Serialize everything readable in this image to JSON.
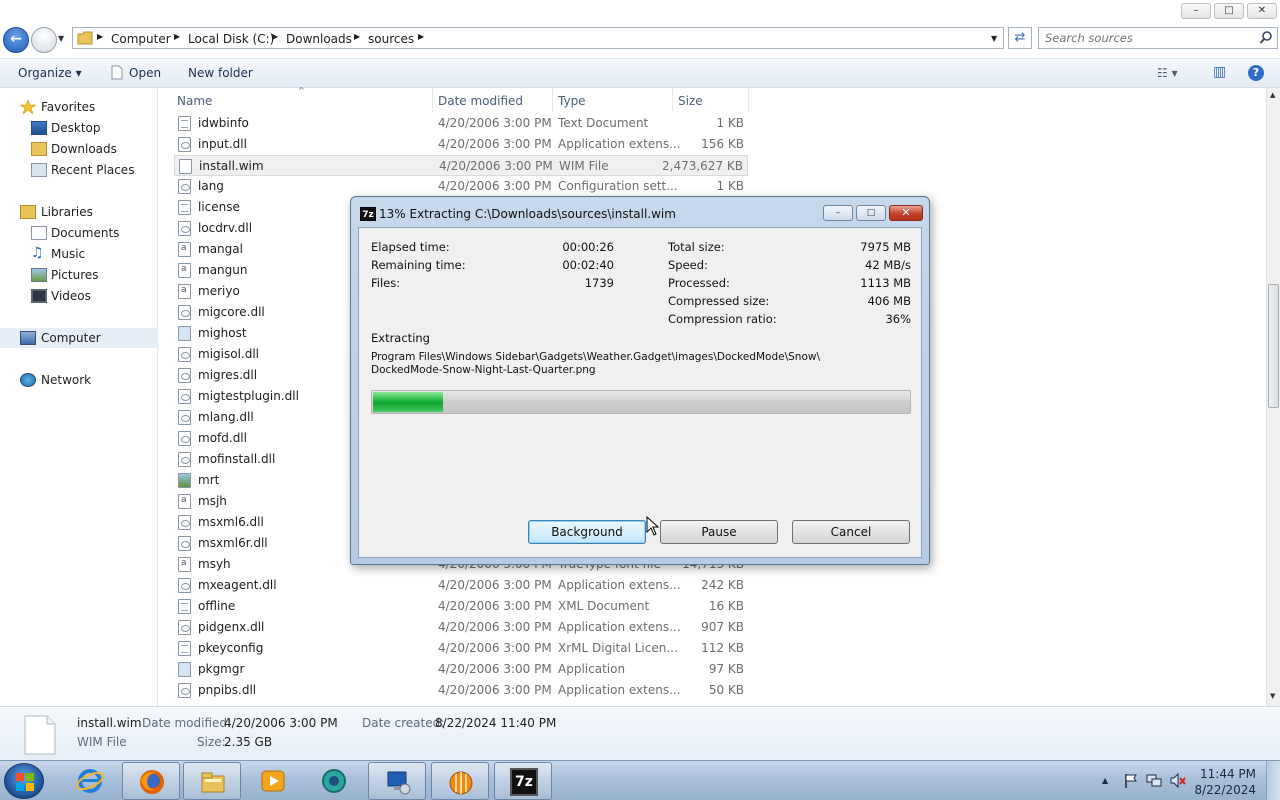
{
  "window": {
    "controls": {
      "minimize": "–",
      "maximize": "□",
      "close": "✕"
    }
  },
  "address": {
    "crumbs": [
      "Computer",
      "Local Disk (C:)",
      "Downloads",
      "sources"
    ],
    "separator": "▶",
    "dropdown": "▼",
    "refresh": "⇄"
  },
  "search": {
    "placeholder": "Search sources"
  },
  "toolbar": {
    "organize": "Organize ▾",
    "open": "Open",
    "new_folder": "New folder",
    "views": "☷ ▾",
    "preview": "▥",
    "help": "?"
  },
  "nav": {
    "favorites": "Favorites",
    "desktop": "Desktop",
    "downloads": "Downloads",
    "recent": "Recent Places",
    "libraries": "Libraries",
    "documents": "Documents",
    "music": "Music",
    "pictures": "Pictures",
    "videos": "Videos",
    "computer": "Computer",
    "network": "Network"
  },
  "columns": {
    "name": "Name",
    "date": "Date modified",
    "type": "Type",
    "size": "Size"
  },
  "files": [
    {
      "name": "idwbinfo",
      "date": "4/20/2006 3:00 PM",
      "type": "Text Document",
      "size": "1 KB",
      "icon": "txt"
    },
    {
      "name": "input.dll",
      "date": "4/20/2006 3:00 PM",
      "type": "Application extens...",
      "size": "156 KB",
      "icon": "dll"
    },
    {
      "name": "install.wim",
      "date": "4/20/2006 3:00 PM",
      "type": "WIM File",
      "size": "2,473,627 KB",
      "icon": "blank",
      "selected": true
    },
    {
      "name": "lang",
      "date": "4/20/2006 3:00 PM",
      "type": "Configuration sett...",
      "size": "1 KB",
      "icon": "dll"
    },
    {
      "name": "license",
      "date": "",
      "type": "",
      "size": "",
      "icon": "txt"
    },
    {
      "name": "locdrv.dll",
      "date": "",
      "type": "",
      "size": "",
      "icon": "dll"
    },
    {
      "name": "mangal",
      "date": "",
      "type": "",
      "size": "",
      "icon": "font"
    },
    {
      "name": "mangun",
      "date": "",
      "type": "",
      "size": "",
      "icon": "font"
    },
    {
      "name": "meriyo",
      "date": "",
      "type": "",
      "size": "",
      "icon": "font"
    },
    {
      "name": "migcore.dll",
      "date": "",
      "type": "",
      "size": "",
      "icon": "dll"
    },
    {
      "name": "mighost",
      "date": "",
      "type": "",
      "size": "",
      "icon": "app"
    },
    {
      "name": "migisol.dll",
      "date": "",
      "type": "",
      "size": "",
      "icon": "dll"
    },
    {
      "name": "migres.dll",
      "date": "",
      "type": "",
      "size": "",
      "icon": "dll"
    },
    {
      "name": "migtestplugin.dll",
      "date": "",
      "type": "",
      "size": "",
      "icon": "dll"
    },
    {
      "name": "mlang.dll",
      "date": "",
      "type": "",
      "size": "",
      "icon": "dll"
    },
    {
      "name": "mofd.dll",
      "date": "",
      "type": "",
      "size": "",
      "icon": "dll"
    },
    {
      "name": "mofinstall.dll",
      "date": "",
      "type": "",
      "size": "",
      "icon": "dll"
    },
    {
      "name": "mrt",
      "date": "",
      "type": "",
      "size": "",
      "icon": "img"
    },
    {
      "name": "msjh",
      "date": "",
      "type": "",
      "size": "",
      "icon": "font"
    },
    {
      "name": "msxml6.dll",
      "date": "",
      "type": "",
      "size": "",
      "icon": "dll"
    },
    {
      "name": "msxml6r.dll",
      "date": "",
      "type": "",
      "size": "",
      "icon": "dll"
    },
    {
      "name": "msyh",
      "date": "4/20/2006 3:00 PM",
      "type": "TrueType font file",
      "size": "14,713 KB",
      "icon": "font"
    },
    {
      "name": "mxeagent.dll",
      "date": "4/20/2006 3:00 PM",
      "type": "Application extens...",
      "size": "242 KB",
      "icon": "dll"
    },
    {
      "name": "offline",
      "date": "4/20/2006 3:00 PM",
      "type": "XML Document",
      "size": "16 KB",
      "icon": "txt"
    },
    {
      "name": "pidgenx.dll",
      "date": "4/20/2006 3:00 PM",
      "type": "Application extens...",
      "size": "907 KB",
      "icon": "dll"
    },
    {
      "name": "pkeyconfig",
      "date": "4/20/2006 3:00 PM",
      "type": "XrML Digital Licen...",
      "size": "112 KB",
      "icon": "txt"
    },
    {
      "name": "pkgmgr",
      "date": "4/20/2006 3:00 PM",
      "type": "Application",
      "size": "97 KB",
      "icon": "app"
    },
    {
      "name": "pnpibs.dll",
      "date": "4/20/2006 3:00 PM",
      "type": "Application extens...",
      "size": "50 KB",
      "icon": "dll"
    }
  ],
  "details": {
    "name": "install.wim",
    "kind": "WIM File",
    "modified_label": "Date modified:",
    "modified": "4/20/2006 3:00 PM",
    "created_label": "Date created:",
    "created": "8/22/2024 11:40 PM",
    "size_label": "Size:",
    "size": "2.35 GB"
  },
  "dialog": {
    "title": "13% Extracting C:\\Downloads\\sources\\install.wim",
    "icon_text": "7z",
    "left_stats": [
      {
        "label": "Elapsed time:",
        "value": "00:00:26"
      },
      {
        "label": "Remaining time:",
        "value": "00:02:40"
      },
      {
        "label": "Files:",
        "value": "1739"
      }
    ],
    "right_stats": [
      {
        "label": "Total size:",
        "value": "7975 MB"
      },
      {
        "label": "Speed:",
        "value": "42 MB/s"
      },
      {
        "label": "Processed:",
        "value": "1113 MB"
      },
      {
        "label": "Compressed size:",
        "value": "406 MB"
      },
      {
        "label": "Compression ratio:",
        "value": "36%"
      }
    ],
    "operation": "Extracting",
    "path_line1": "Program Files\\Windows Sidebar\\Gadgets\\Weather.Gadget\\images\\DockedMode\\Snow\\",
    "path_line2": "DockedMode-Snow-Night-Last-Quarter.png",
    "progress_fraction": 0.13,
    "buttons": {
      "background": "Background",
      "pause": "Pause",
      "cancel": "Cancel"
    }
  },
  "taskbar": {
    "apps": [
      "internet-explorer",
      "firefox",
      "file-explorer",
      "media-player",
      "windows-update",
      "remote-desktop",
      "hard-drive-tool",
      "7-zip"
    ],
    "seven_zip_label": "7z",
    "tray_up": "▲",
    "time": "11:44 PM",
    "date": "8/22/2024"
  },
  "colors": {
    "progress": "#19b43a",
    "selection": "#f0f0f0",
    "accent": "#1c5fb8"
  }
}
